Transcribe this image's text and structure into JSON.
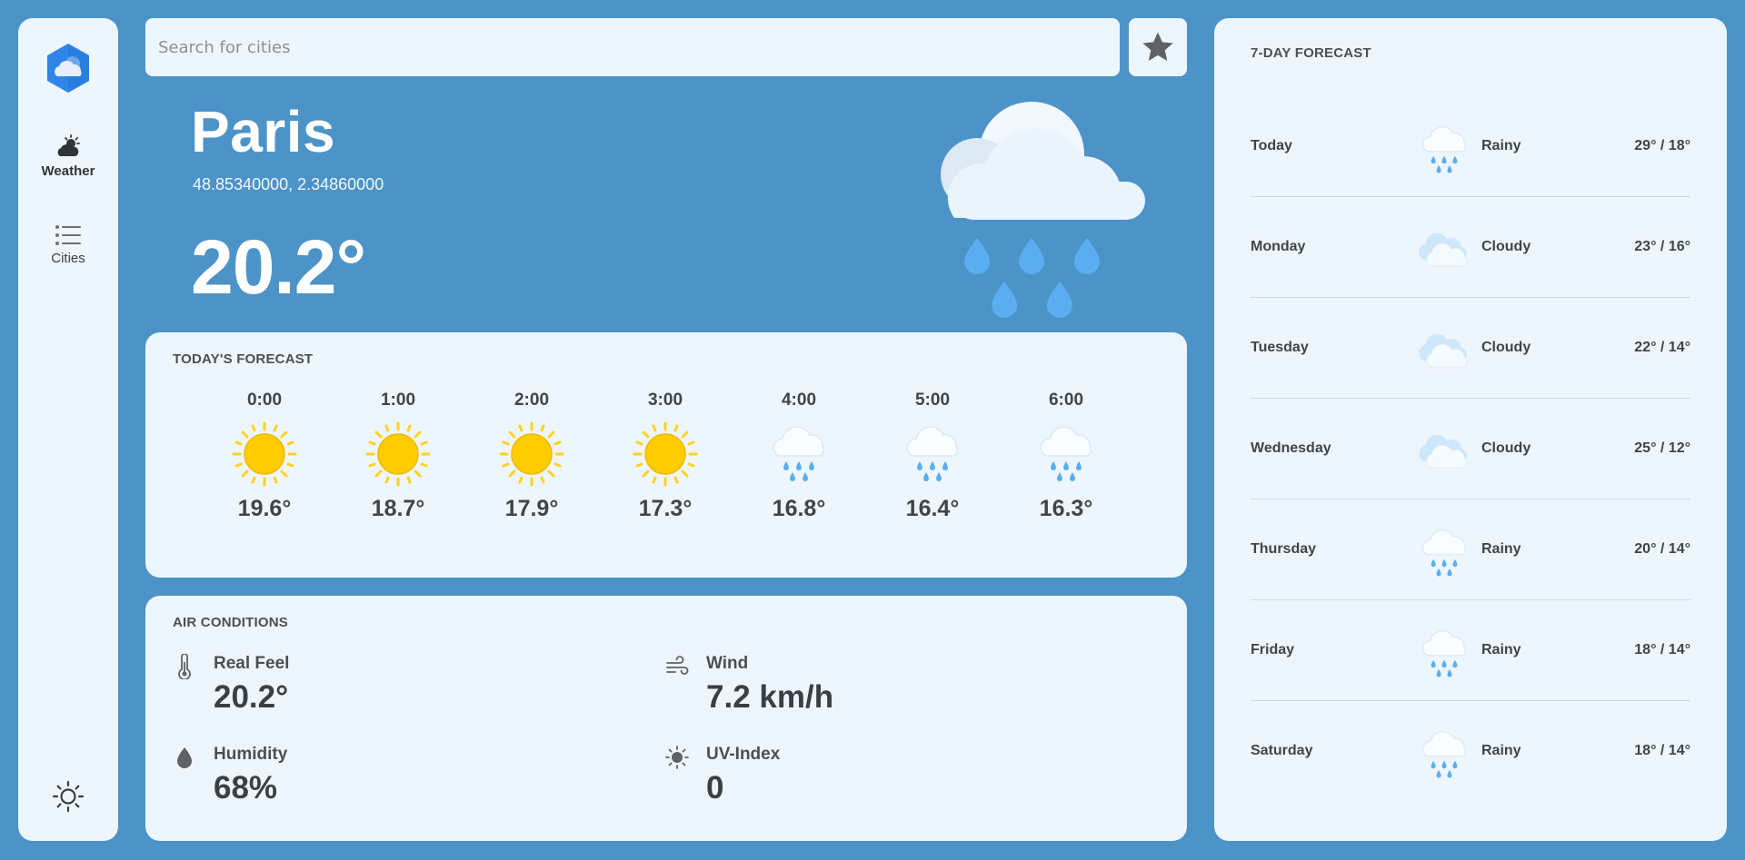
{
  "sidebar": {
    "logo": "weather-app-logo",
    "items": [
      {
        "label": "Weather",
        "icon": "partly-sunny-icon"
      },
      {
        "label": "Cities",
        "icon": "list-icon"
      }
    ],
    "theme_icon": "sun-outline-icon"
  },
  "search": {
    "placeholder": "Search for cities",
    "value": ""
  },
  "favorite_icon": "star-icon",
  "current": {
    "city": "Paris",
    "coords": "48.85340000, 2.34860000",
    "temperature": "20.2°",
    "icon": "rain-cloud-icon"
  },
  "today_forecast": {
    "title": "TODAY'S FORECAST",
    "hours": [
      {
        "time": "0:00",
        "temp": "19.6°",
        "icon": "sun"
      },
      {
        "time": "1:00",
        "temp": "18.7°",
        "icon": "sun"
      },
      {
        "time": "2:00",
        "temp": "17.9°",
        "icon": "sun"
      },
      {
        "time": "3:00",
        "temp": "17.3°",
        "icon": "sun"
      },
      {
        "time": "4:00",
        "temp": "16.8°",
        "icon": "rain"
      },
      {
        "time": "5:00",
        "temp": "16.4°",
        "icon": "rain"
      },
      {
        "time": "6:00",
        "temp": "16.3°",
        "icon": "rain"
      }
    ]
  },
  "air_conditions": {
    "title": "AIR CONDITIONS",
    "real_feel": {
      "label": "Real Feel",
      "value": "20.2°",
      "icon": "thermometer-icon"
    },
    "wind": {
      "label": "Wind",
      "value": "7.2 km/h",
      "icon": "wind-icon"
    },
    "humidity": {
      "label": "Humidity",
      "value": "68%",
      "icon": "droplet-icon"
    },
    "uv": {
      "label": "UV-Index",
      "value": "0",
      "icon": "sun-icon"
    }
  },
  "week_forecast": {
    "title": "7-DAY FORECAST",
    "days": [
      {
        "day": "Today",
        "condition": "Rainy",
        "temps": "29° / 18°",
        "icon": "rain"
      },
      {
        "day": "Monday",
        "condition": "Cloudy",
        "temps": "23° / 16°",
        "icon": "cloud"
      },
      {
        "day": "Tuesday",
        "condition": "Cloudy",
        "temps": "22° / 14°",
        "icon": "cloud"
      },
      {
        "day": "Wednesday",
        "condition": "Cloudy",
        "temps": "25° / 12°",
        "icon": "cloud"
      },
      {
        "day": "Thursday",
        "condition": "Rainy",
        "temps": "20° / 14°",
        "icon": "rain"
      },
      {
        "day": "Friday",
        "condition": "Rainy",
        "temps": "18° / 14°",
        "icon": "rain"
      },
      {
        "day": "Saturday",
        "condition": "Rainy",
        "temps": "18° / 14°",
        "icon": "rain"
      }
    ]
  },
  "colors": {
    "background": "#4c93c8",
    "card": "#eef6fd",
    "sun": "#ffcc00",
    "rain": "#5aaef0"
  }
}
